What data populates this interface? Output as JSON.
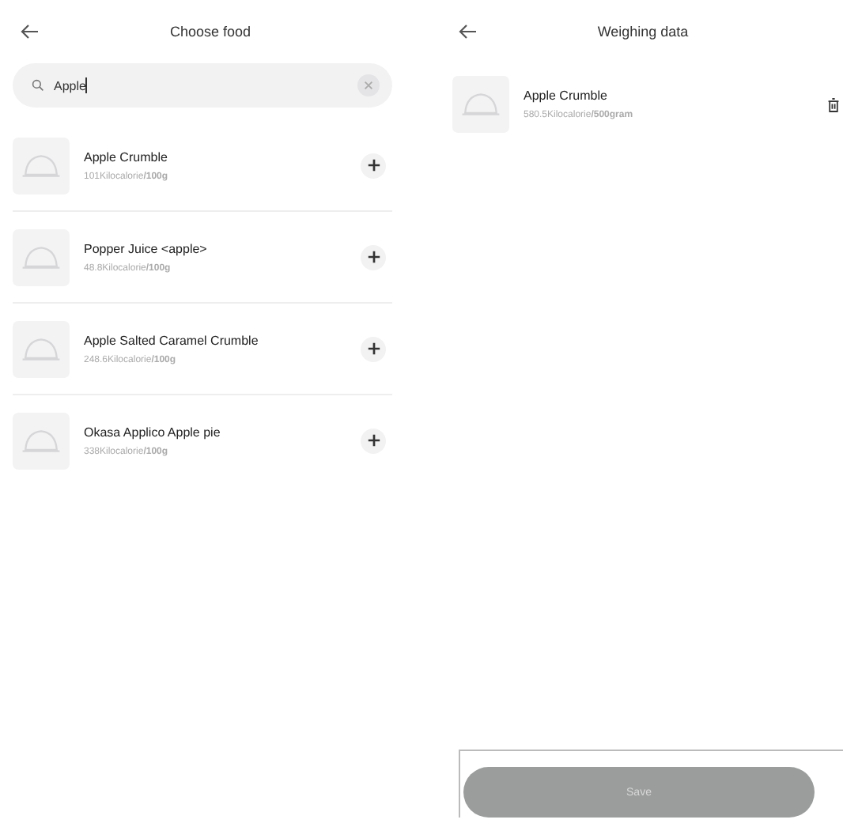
{
  "choose_panel": {
    "title": "Choose food",
    "search": {
      "value": "Apple"
    },
    "foods": [
      {
        "name": "Apple Crumble",
        "energy": "101Kilocalorie**/100g**"
      },
      {
        "name": "Popper Juice <apple>",
        "energy": "48.8Kilocalorie**/100g**"
      },
      {
        "name": "Apple Salted Caramel Crumble",
        "energy": "248.6Kilocalorie**/100g**"
      },
      {
        "name": "Okasa Applico Apple pie",
        "energy": "338Kilocalorie**/100g**"
      }
    ]
  },
  "weighing_panel": {
    "title": "Weighing data",
    "items": [
      {
        "name": "Apple Crumble",
        "energy": "580.5Kilocalorie**/500gram**"
      }
    ],
    "save_button": {
      "label": "Save",
      "disabled": true
    }
  }
}
